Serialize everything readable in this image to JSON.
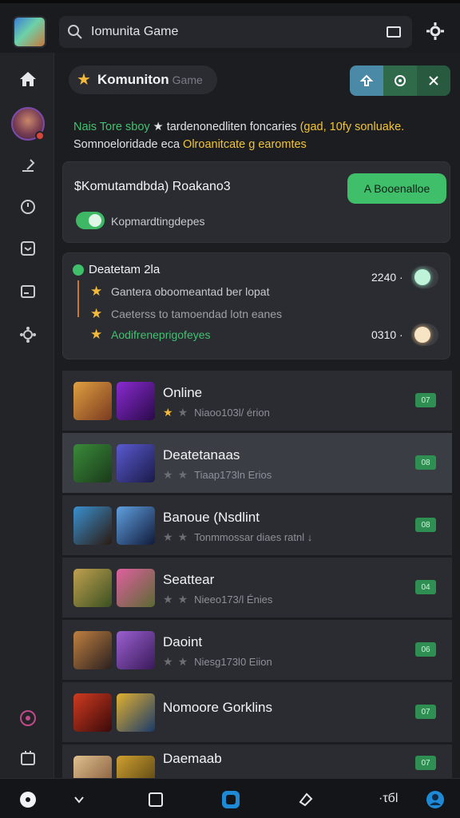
{
  "search": {
    "text": "Iomunita Game"
  },
  "header": {
    "title": "Komuniton",
    "subtitle": "Game"
  },
  "promo": {
    "line1_green": "Nais Tore sboy",
    "line1_white": "★ tardenonedliten foncaries",
    "line1_yellow": "(gad, 10fy sonluake.",
    "line2_white": "Somnoeloridade eca",
    "line2_yellow": "Olroanitcate g earomtes"
  },
  "card_community": {
    "title": "$Komutamdbda) Roakano3",
    "button_label": "A Booenalloe",
    "toggle_label": "Kopmardtingdepes",
    "toggle_on": true
  },
  "card_status": {
    "title": "Deatetam 2la",
    "rows": [
      {
        "text": "Gantera oboomeantad ber lopat",
        "color": "#c7c9cf"
      },
      {
        "text": "Caeterss to tamoendad lotn eanes",
        "color": "#9ea1a8"
      },
      {
        "text": "Aodifreneprigofeyes",
        "color": "#43c070"
      }
    ],
    "value1": "2240 ·",
    "value2": "0310 ·"
  },
  "games": [
    {
      "name": "Online",
      "meta": "Niaoo103l/ érion",
      "badge": "07",
      "stars": 1,
      "thumb_a": [
        "#e0a040",
        "#7a3a20"
      ],
      "thumb_b": [
        "#8a2ad0",
        "#2a0a4a"
      ]
    },
    {
      "name": "Deatetanaas",
      "meta": "Tiaap173ln Erios",
      "badge": "08",
      "stars": 0,
      "thumb_a": [
        "#3a8a3a",
        "#1a3a1a"
      ],
      "thumb_b": [
        "#5a5ad0",
        "#1a1a4a"
      ],
      "selected": true
    },
    {
      "name": "Banoue (Nsdlint",
      "meta": "Tonmmossar diaes ratnl ↓",
      "badge": "08",
      "stars": 0,
      "thumb_a": [
        "#3a90d0",
        "#2a1a10"
      ],
      "thumb_b": [
        "#60a0e0",
        "#101a3a"
      ]
    },
    {
      "name": "Seattear",
      "meta": "Nieeo173/l Énies",
      "badge": "04",
      "stars": 0,
      "thumb_a": [
        "#c0a050",
        "#3a5020"
      ],
      "thumb_b": [
        "#e060a0",
        "#5a6a30"
      ]
    },
    {
      "name": "Daoint",
      "meta": "Niesg173l0 Eiion",
      "badge": "06",
      "stars": 0,
      "thumb_a": [
        "#c08040",
        "#2a2020"
      ],
      "thumb_b": [
        "#9a60d0",
        "#3a1a5a"
      ]
    },
    {
      "name": "Nomoore Gorklins",
      "meta": "",
      "badge": "07",
      "stars": 0,
      "thumb_a": [
        "#d03a20",
        "#3a0a0a"
      ],
      "thumb_b": [
        "#e0b030",
        "#1a3a6a"
      ]
    },
    {
      "name": "Daemaab",
      "meta": "",
      "badge": "07",
      "stars": 0,
      "thumb_a": [
        "#e0c090",
        "#7a5030"
      ],
      "thumb_b": [
        "#d0a030",
        "#4a3a10"
      ]
    }
  ],
  "bottom": {
    "label": "·τбl"
  },
  "colors": {
    "accent_green": "#3fbf6a",
    "star": "#f4b93a",
    "bg": "#1c1d21"
  }
}
